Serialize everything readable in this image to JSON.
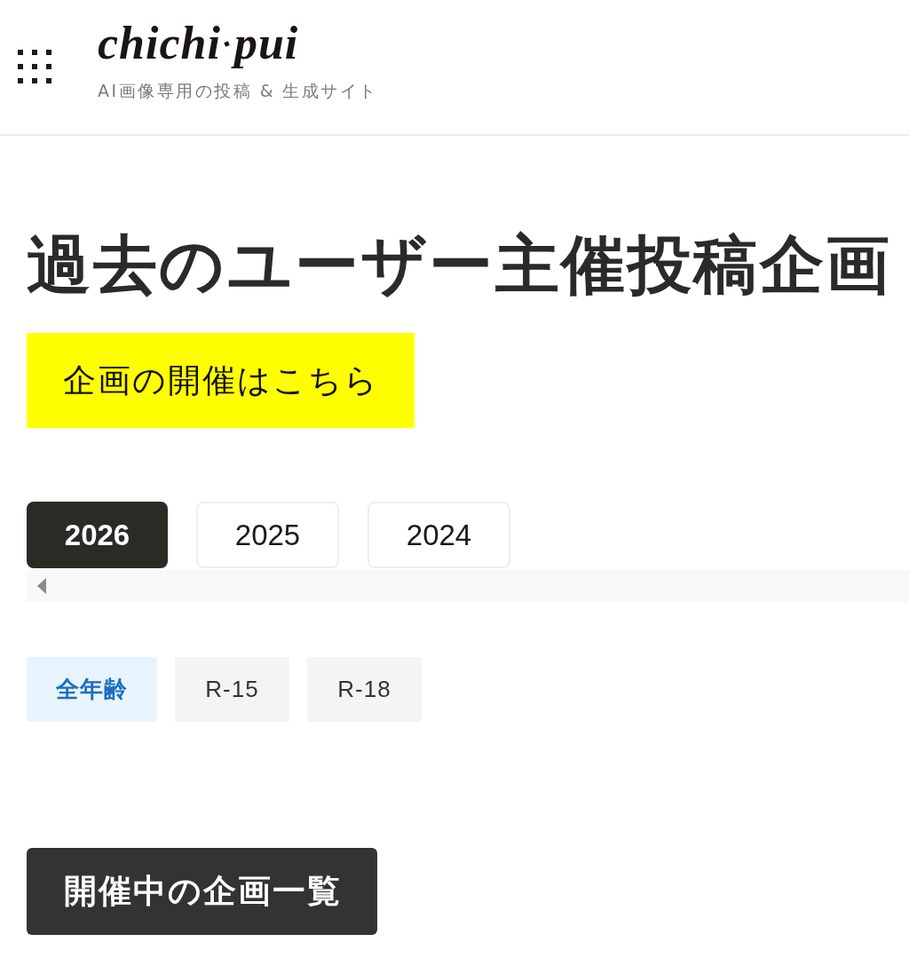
{
  "header": {
    "logo": [
      "chichi",
      "pui"
    ],
    "tagline": "AI画像専用の投稿 & 生成サイト"
  },
  "page_title": "過去のユーザー主催投稿企画",
  "host_button": "企画の開催はこちら",
  "year_tabs": [
    {
      "label": "2026",
      "selected": true
    },
    {
      "label": "2025",
      "selected": false
    },
    {
      "label": "2024",
      "selected": false
    }
  ],
  "rating_tabs": [
    {
      "label": "全年齢",
      "selected": true
    },
    {
      "label": "R-15",
      "selected": false
    },
    {
      "label": "R-18",
      "selected": false
    }
  ],
  "ongoing_button": "開催中の企画一覧"
}
